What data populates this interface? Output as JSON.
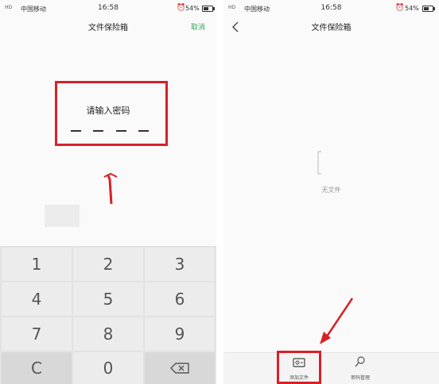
{
  "status_left": {
    "signal": "HD",
    "carrier": "中国移动",
    "time": "16:58",
    "battery": "54%"
  },
  "status_right": {
    "signal": "HD",
    "carrier": "中国移动",
    "time": "16:58",
    "battery": "54%"
  },
  "left_screen": {
    "title": "文件保险箱",
    "cancel_label": "取消",
    "password_prompt": "请输入密码",
    "arrow_glyph": "↑",
    "keys": [
      "1",
      "2",
      "3",
      "4",
      "5",
      "6",
      "7",
      "8",
      "9",
      "C",
      "0"
    ]
  },
  "right_screen": {
    "title": "文件保险箱",
    "empty_text": "无文件",
    "add_file_label": "添加文件",
    "password_manage_label": "密码管理"
  },
  "colors": {
    "accent_green": "#3aa85c",
    "annotation_red": "#d92027"
  },
  "icons": {
    "back": "back-chevron-icon",
    "delete": "backspace-icon",
    "add_file": "add-file-icon",
    "password_manage": "search-key-icon"
  }
}
